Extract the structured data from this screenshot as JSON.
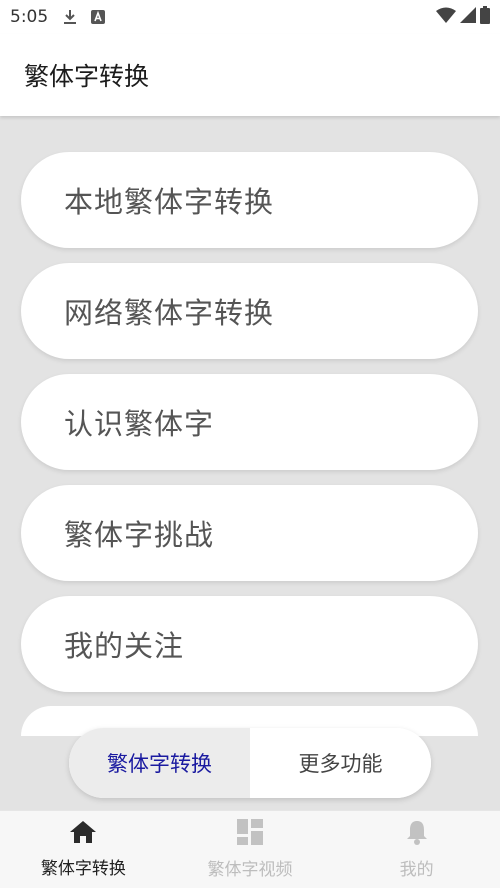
{
  "status_bar": {
    "time": "5:05",
    "icons": [
      "download-icon",
      "font-a-icon",
      "wifi-icon",
      "signal-icon",
      "battery-icon"
    ]
  },
  "app_bar": {
    "title": "繁体字转换"
  },
  "menu": {
    "items": [
      {
        "label": "本地繁体字转换"
      },
      {
        "label": "网络繁体字转换"
      },
      {
        "label": "认识繁体字"
      },
      {
        "label": "繁体字挑战"
      },
      {
        "label": "我的关注"
      }
    ]
  },
  "segmented": {
    "active_label": "繁体字转换",
    "other_label": "更多功能",
    "active_color": "#1a1aa0"
  },
  "bottom_nav": {
    "items": [
      {
        "label": "繁体字转换",
        "icon": "home-icon",
        "active": true
      },
      {
        "label": "繁体字视频",
        "icon": "grid-icon",
        "active": false
      },
      {
        "label": "我的",
        "icon": "bell-icon",
        "active": false
      }
    ]
  },
  "colors": {
    "background": "#e3e3e3",
    "surface": "#ffffff",
    "text": "#555555"
  }
}
